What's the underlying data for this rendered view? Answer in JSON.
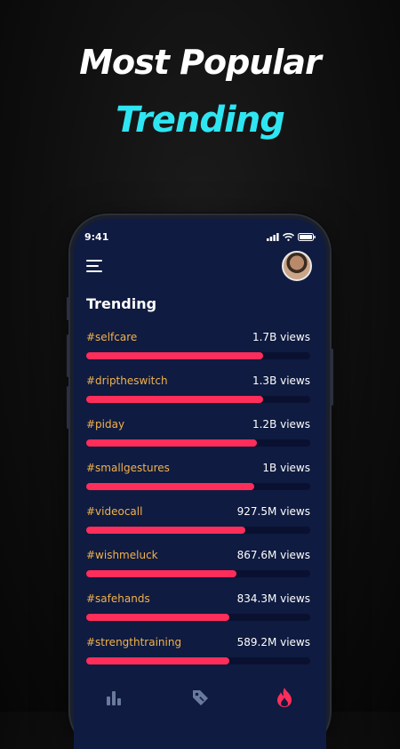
{
  "promo": {
    "headline": "Most Popular",
    "subheadline": "Trending"
  },
  "status_bar": {
    "time": "9:41"
  },
  "header": {
    "menu_icon": "hamburger-menu-icon",
    "avatar_icon": "user-avatar"
  },
  "section": {
    "title": "Trending"
  },
  "trending": [
    {
      "tag": "#selfcare",
      "views": "1.7B views",
      "fraction": 0.79
    },
    {
      "tag": "#driptheswitch",
      "views": "1.3B views",
      "fraction": 0.79
    },
    {
      "tag": "#piday",
      "views": "1.2B views",
      "fraction": 0.76
    },
    {
      "tag": "#smallgestures",
      "views": "1B views",
      "fraction": 0.75
    },
    {
      "tag": "#videocall",
      "views": "927.5M views",
      "fraction": 0.71
    },
    {
      "tag": "#wishmeluck",
      "views": "867.6M views",
      "fraction": 0.67
    },
    {
      "tag": "#safehands",
      "views": "834.3M views",
      "fraction": 0.64
    },
    {
      "tag": "#strengthtraining",
      "views": "589.2M views",
      "fraction": 0.64
    }
  ],
  "tabs": [
    {
      "name": "stats",
      "icon": "bar-chart-icon",
      "active": false
    },
    {
      "name": "tags",
      "icon": "tag-icon",
      "active": false
    },
    {
      "name": "trending",
      "icon": "flame-icon",
      "active": true
    }
  ],
  "colors": {
    "accent_cyan": "#2ee6f2",
    "bar_fill": "#ff2d5a",
    "tag_text": "#f2b24c",
    "screen_bg": "#0f1b40",
    "inactive_tab": "#6a7a9c"
  }
}
